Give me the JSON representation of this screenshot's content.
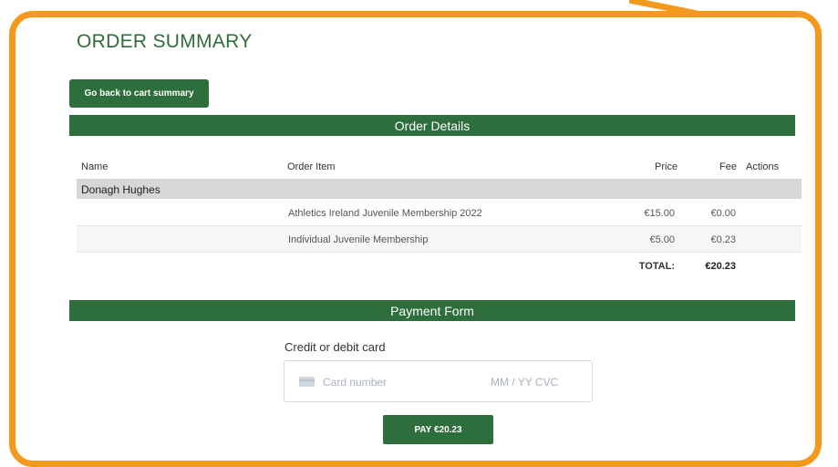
{
  "page": {
    "title": "ORDER SUMMARY"
  },
  "back_button": {
    "label": "Go back to cart summary"
  },
  "order_details": {
    "heading": "Order Details",
    "columns": {
      "name": "Name",
      "item": "Order Item",
      "price": "Price",
      "fee": "Fee",
      "actions": "Actions"
    },
    "customer": "Donagh Hughes",
    "rows": [
      {
        "item": "Athletics Ireland Juvenile Membership 2022",
        "price": "€15.00",
        "fee": "€0.00"
      },
      {
        "item": "Individual Juvenile Membership",
        "price": "€5.00",
        "fee": "€0.23"
      }
    ],
    "total_label": "TOTAL:",
    "total_value": "€20.23"
  },
  "payment": {
    "heading": "Payment Form",
    "card_label": "Credit or debit card",
    "card_number_placeholder": "Card number",
    "expiry_cvc_placeholder": "MM / YY  CVC",
    "pay_button": "PAY €20.23"
  },
  "colors": {
    "accent": "#2e6e3c",
    "frame": "#f39a1e"
  },
  "icons": {
    "card": "credit-card-icon"
  }
}
